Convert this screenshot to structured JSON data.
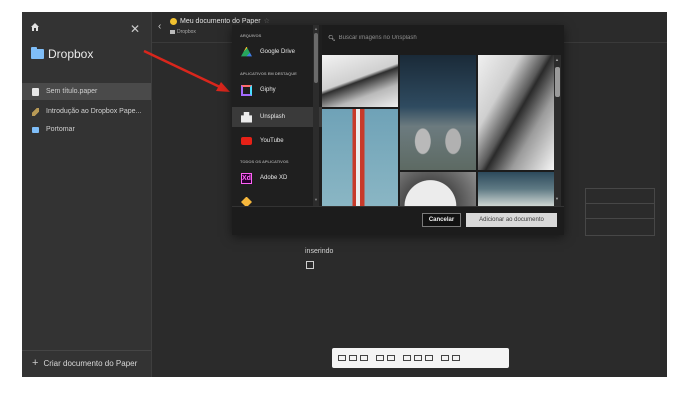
{
  "sidebar": {
    "brand": "Dropbox",
    "items": [
      {
        "label": "Sem título.paper",
        "icon": "paper-doc-icon"
      },
      {
        "label": "Introdução ao Dropbox Pape...",
        "icon": "pencil-icon"
      },
      {
        "label": "Portomar",
        "icon": "folder-icon"
      }
    ],
    "create_label": "Criar documento do Paper"
  },
  "header": {
    "title": "Meu documento do Paper",
    "path": "Dropbox"
  },
  "editor": {
    "text_line": "inserindo"
  },
  "modal": {
    "sections": {
      "files": "ARQUIVOS",
      "featured": "APLICATIVOS EM DESTAQUE",
      "all": "TODOS OS APLICATIVOS"
    },
    "apps": [
      {
        "label": "Google Drive",
        "icon": "google-drive-icon"
      },
      {
        "label": "Giphy",
        "icon": "giphy-icon"
      },
      {
        "label": "Unsplash",
        "icon": "unsplash-icon",
        "selected": true
      },
      {
        "label": "YouTube",
        "icon": "youtube-icon"
      },
      {
        "label": "Adobe XD",
        "icon": "adobe-xd-icon"
      }
    ],
    "search_placeholder": "Buscar imagens no Unsplash",
    "cancel_label": "Cancelar",
    "add_label": "Adicionar ao documento"
  },
  "colors": {
    "app_bg": "#2b2b2b",
    "sidebar_bg": "#333333",
    "modal_bg": "#1c1c1c",
    "accent_red": "#d9261c"
  }
}
